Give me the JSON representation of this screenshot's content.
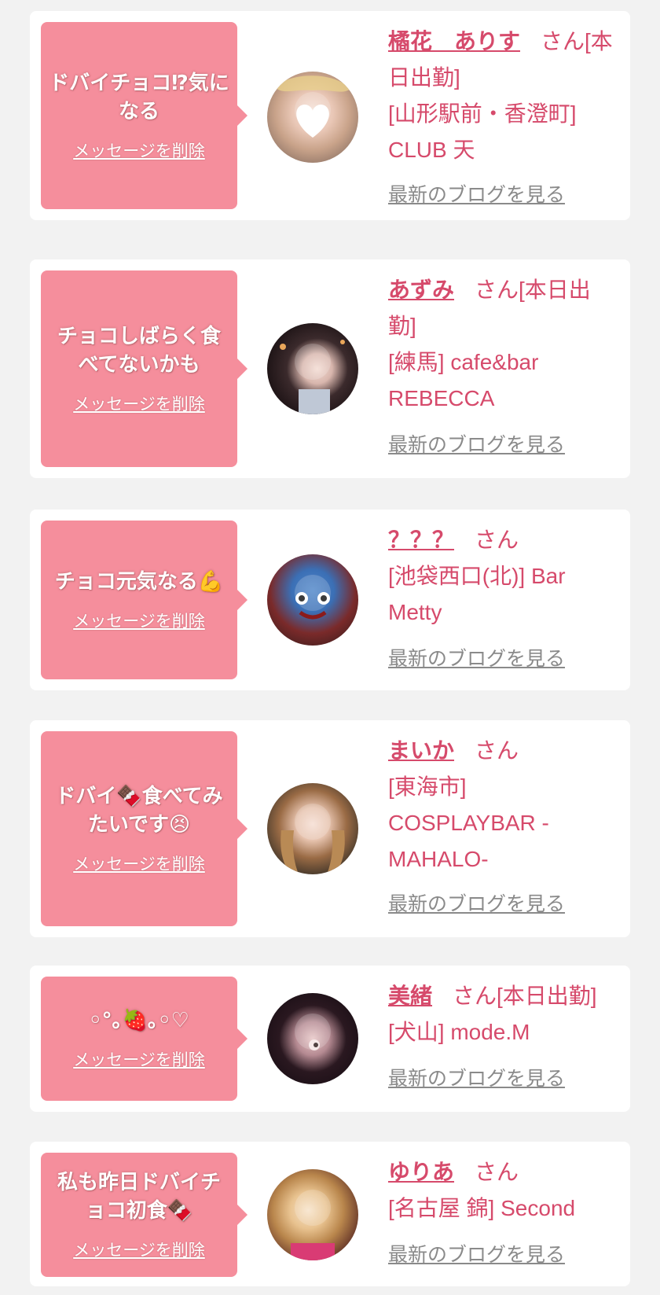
{
  "colors": {
    "background": "#f2f2f2",
    "card": "#ffffff",
    "bubble": "#f58e9c",
    "accent_text": "#d64a6b",
    "link_gray": "#8a8a8a"
  },
  "delete_label": "メッセージを削除",
  "blog_label": "最新のブログを見る",
  "entries": [
    {
      "message": "ドバイチョコ⁉気になる",
      "name": "橘花　ありす",
      "honorific_status": "さん[本日出勤]",
      "location": "[山形駅前・香澄町] CLUB 天",
      "avatar_style": "blonde-hair-heart-sticker"
    },
    {
      "message": "チョコしばらく食べてないかも",
      "name": "あずみ",
      "honorific_status": "さん[本日出勤]",
      "location": "[練馬] cafe&bar REBECCA",
      "avatar_style": "dark-hair-night"
    },
    {
      "message": "チョコ元気なる💪",
      "name": "？？？",
      "honorific_status": "さん",
      "location": "[池袋西口(北)] Bar Metty",
      "avatar_style": "blue-slime-mask"
    },
    {
      "message": "ドバイ🍫食べてみたいです😣",
      "name": "まいか",
      "honorific_status": "さん",
      "location": "[東海市] COSPLAYBAR -MAHALO-",
      "avatar_style": "brown-wavy-hair"
    },
    {
      "message": "◦°｡🍓｡◦♡",
      "name": "美緒",
      "honorific_status": "さん[本日出勤]",
      "location": "[犬山] mode.M",
      "avatar_style": "dark-pink-filter"
    },
    {
      "message": "私も昨日ドバイチョコ初食🍫",
      "name": "ゆりあ",
      "honorific_status": "さん",
      "location": "[名古屋 錦] Second",
      "avatar_style": "blonde-pink-outfit"
    }
  ]
}
